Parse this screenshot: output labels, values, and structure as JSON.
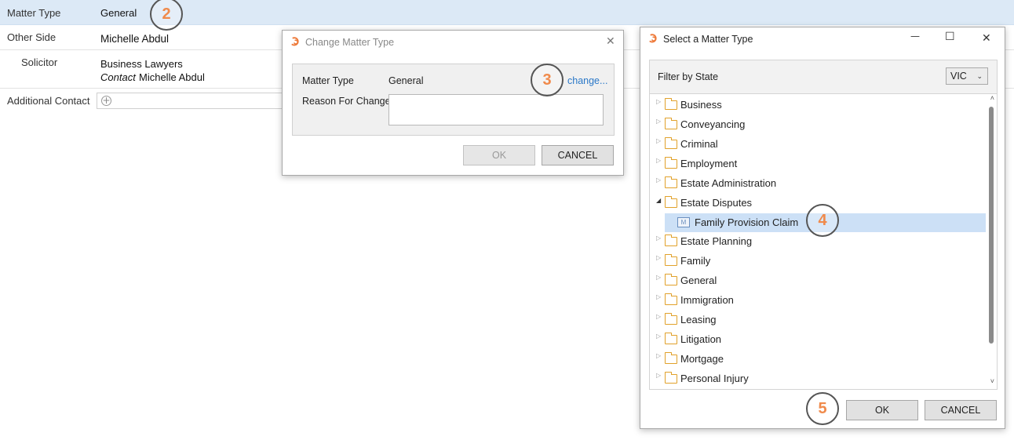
{
  "form": {
    "matter_type_label": "Matter Type",
    "matter_type_value": "General",
    "other_side_label": "Other Side",
    "other_side_value": "Michelle Abdul",
    "solicitor_label": "Solicitor",
    "solicitor_firm": "Business Lawyers",
    "contact_label": "Contact",
    "contact_value": "Michelle Abdul",
    "additional_contact_label": "Additional Contact",
    "add_icon": "plus-circle-icon",
    "add_glyph": "+"
  },
  "steps": [
    "2",
    "3",
    "4",
    "5"
  ],
  "change_dialog": {
    "title": "Change Matter Type",
    "close_glyph": "✕",
    "matter_type_label": "Matter Type",
    "matter_type_value": "General",
    "change_link": "change...",
    "reason_label": "Reason For Change",
    "reason_value": "",
    "ok_label": "OK",
    "cancel_label": "CANCEL"
  },
  "select_dialog": {
    "title": "Select a Matter Type",
    "minimize_glyph": "—",
    "maximize_glyph": "☐",
    "close_glyph": "✕",
    "filter_label": "Filter by State",
    "state_value": "VIC",
    "chevron_glyph": "⌄",
    "items": [
      {
        "label": "Business",
        "expanded": false
      },
      {
        "label": "Conveyancing",
        "expanded": false
      },
      {
        "label": "Criminal",
        "expanded": false
      },
      {
        "label": "Employment",
        "expanded": false
      },
      {
        "label": "Estate Administration",
        "expanded": false
      },
      {
        "label": "Estate Disputes",
        "expanded": true
      }
    ],
    "child_item": "Family Provision Claim",
    "child_icon_glyph": "M",
    "items_after": [
      {
        "label": "Estate Planning"
      },
      {
        "label": "Family"
      },
      {
        "label": "General"
      },
      {
        "label": "Immigration"
      },
      {
        "label": "Leasing"
      },
      {
        "label": "Litigation"
      },
      {
        "label": "Mortgage"
      },
      {
        "label": "Personal Injury"
      }
    ],
    "collapsed_glyph": "▷",
    "expanded_glyph": "◢",
    "scroll_up_glyph": "˄",
    "scroll_down_glyph": "˅",
    "ok_label": "OK",
    "cancel_label": "CANCEL"
  },
  "colors": {
    "highlight_row": "#dce9f6",
    "step_number": "#f08a4b",
    "link": "#2a78c8",
    "folder": "#e1a12a",
    "selected_item": "#cce0f6"
  }
}
